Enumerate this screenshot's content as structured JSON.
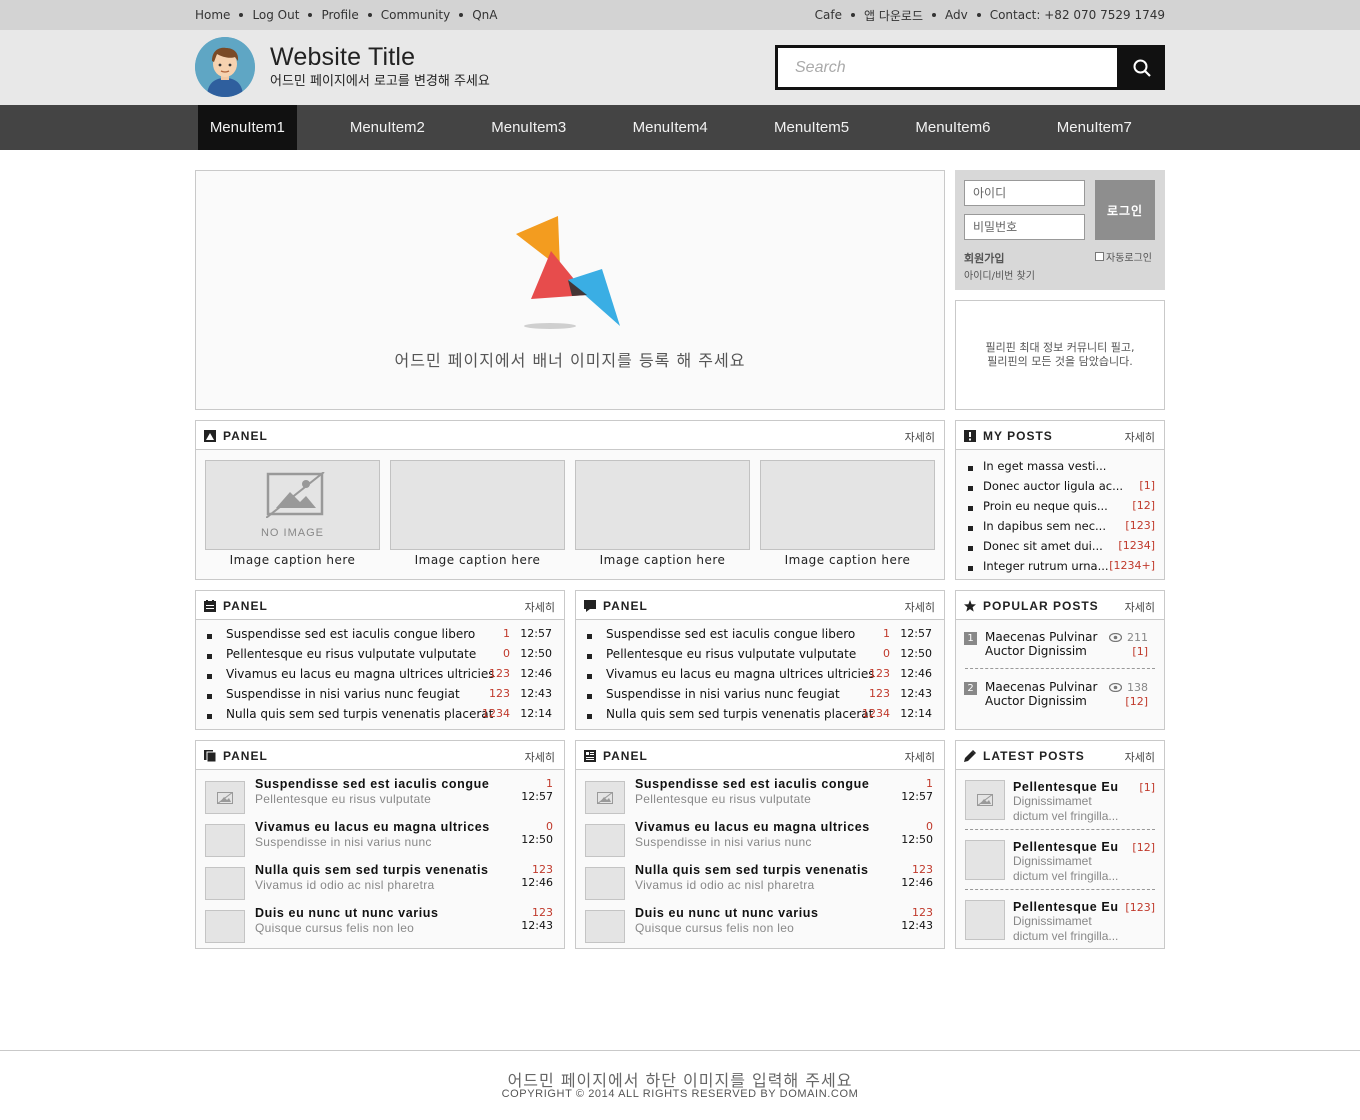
{
  "topbar": {
    "left_links": [
      "Home",
      "Log Out",
      "Profile",
      "Community",
      "QnA"
    ],
    "right_links": [
      "Cafe",
      "앱 다운로드",
      "Adv",
      "Contact: +82 070 7529 1749"
    ]
  },
  "header": {
    "title": "Website Title",
    "subtitle": "어드민 페이지에서 로고를 변경해 주세요",
    "search_placeholder": "Search"
  },
  "nav": [
    "MenuItem1",
    "MenuItem2",
    "MenuItem3",
    "MenuItem4",
    "MenuItem5",
    "MenuItem6",
    "MenuItem7"
  ],
  "banner": {
    "text": "어드민 페이지에서 배너 이미지를 등록 해 주세요"
  },
  "login": {
    "id_placeholder": "아이디",
    "pw_placeholder": "비밀번호",
    "button": "로그인",
    "join": "회원가입",
    "find": "아이디/비번 찾기",
    "auto": "자동로그인"
  },
  "info": {
    "line1": "필리핀 최대 정보 커뮤니티 필고,",
    "line2": "필리핀의 모든 것을 담았습니다."
  },
  "more": "자세히",
  "gallery": {
    "title": "PANEL",
    "no_image": "NO IMAGE",
    "captions": [
      "Image caption here",
      "Image caption here",
      "Image caption here",
      "Image caption here"
    ]
  },
  "my_posts": {
    "title": "MY POSTS",
    "items": [
      {
        "t": "In eget massa vesti...",
        "c": ""
      },
      {
        "t": "Donec auctor ligula ac...",
        "c": "[1]"
      },
      {
        "t": "Proin eu neque quis...",
        "c": "[12]"
      },
      {
        "t": "In dapibus sem nec...",
        "c": "[123]"
      },
      {
        "t": "Donec sit amet dui...",
        "c": "[1234]"
      },
      {
        "t": "Integer rutrum urna...",
        "c": "[1234+]"
      }
    ]
  },
  "list_panels": [
    {
      "title": "PANEL",
      "items": [
        {
          "t": "Suspendisse sed est iaculis congue libero",
          "c": "1",
          "tm": "12:57"
        },
        {
          "t": "Pellentesque eu risus vulputate vulputate",
          "c": "0",
          "tm": "12:50"
        },
        {
          "t": "Vivamus eu lacus eu magna ultrices ultricies",
          "c": "123",
          "tm": "12:46"
        },
        {
          "t": "Suspendisse in nisi varius nunc feugiat",
          "c": "123",
          "tm": "12:43"
        },
        {
          "t": "Nulla quis sem sed turpis venenatis placerat",
          "c": "1234",
          "tm": "12:14"
        }
      ]
    },
    {
      "title": "PANEL",
      "items": [
        {
          "t": "Suspendisse sed est iaculis congue libero",
          "c": "1",
          "tm": "12:57"
        },
        {
          "t": "Pellentesque eu risus vulputate vulputate",
          "c": "0",
          "tm": "12:50"
        },
        {
          "t": "Vivamus eu lacus eu magna ultrices ultricies",
          "c": "123",
          "tm": "12:46"
        },
        {
          "t": "Suspendisse in nisi varius nunc feugiat",
          "c": "123",
          "tm": "12:43"
        },
        {
          "t": "Nulla quis sem sed turpis venenatis placerat",
          "c": "1234",
          "tm": "12:14"
        }
      ]
    }
  ],
  "popular": {
    "title": "POPULAR POSTS",
    "items": [
      {
        "n": "1",
        "t1": "Maecenas Pulvinar",
        "t2": "Auctor Dignissim",
        "v": "211",
        "c": "[1]"
      },
      {
        "n": "2",
        "t1": "Maecenas Pulvinar",
        "t2": "Auctor Dignissim",
        "v": "138",
        "c": "[12]"
      }
    ]
  },
  "thumb_panels": [
    {
      "title": "PANEL",
      "items": [
        {
          "t1": "Suspendisse sed est iaculis congue",
          "t2": "Pellentesque eu risus vulputate",
          "c": "1",
          "tm": "12:57"
        },
        {
          "t1": "Vivamus eu lacus eu magna ultrices",
          "t2": "Suspendisse in nisi varius nunc",
          "c": "0",
          "tm": "12:50"
        },
        {
          "t1": "Nulla quis sem sed turpis venenatis",
          "t2": "Vivamus id odio ac nisl pharetra",
          "c": "123",
          "tm": "12:46"
        },
        {
          "t1": "Duis eu nunc ut nunc varius",
          "t2": "Quisque cursus felis non leo",
          "c": "123",
          "tm": "12:43"
        }
      ]
    },
    {
      "title": "PANEL",
      "items": [
        {
          "t1": "Suspendisse sed est iaculis congue",
          "t2": "Pellentesque eu risus vulputate",
          "c": "1",
          "tm": "12:57"
        },
        {
          "t1": "Vivamus eu lacus eu magna ultrices",
          "t2": "Suspendisse in nisi varius nunc",
          "c": "0",
          "tm": "12:50"
        },
        {
          "t1": "Nulla quis sem sed turpis venenatis",
          "t2": "Vivamus id odio ac nisl pharetra",
          "c": "123",
          "tm": "12:46"
        },
        {
          "t1": "Duis eu nunc ut nunc varius",
          "t2": "Quisque cursus felis non leo",
          "c": "123",
          "tm": "12:43"
        }
      ]
    }
  ],
  "latest": {
    "title": "LATEST POSTS",
    "items": [
      {
        "t1": "Pellentesque Eu",
        "t2": "Dignissimamet",
        "t3": "dictum vel fringilla...",
        "c": "[1]"
      },
      {
        "t1": "Pellentesque Eu",
        "t2": "Dignissimamet",
        "t3": "dictum vel fringilla...",
        "c": "[12]"
      },
      {
        "t1": "Pellentesque Eu",
        "t2": "Dignissimamet",
        "t3": "dictum vel fringilla...",
        "c": "[123]"
      }
    ]
  },
  "footer": {
    "line1": "어드민 페이지에서 하단 이미지를 입력해 주세요",
    "line2": "COPYRIGHT © 2014 ALL RIGHTS RESERVED BY DOMAIN.COM"
  },
  "colors": {
    "accent_count": "#c0392b",
    "nav_bg": "#444444",
    "nav_active": "#111111"
  }
}
